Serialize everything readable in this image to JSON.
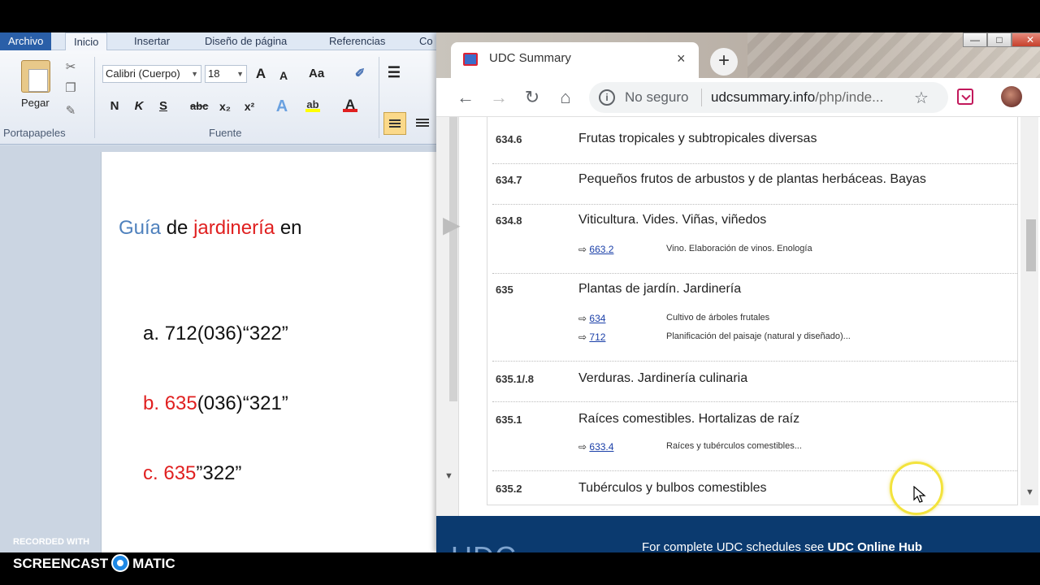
{
  "word": {
    "tabs": [
      "Archivo",
      "Inicio",
      "Insertar",
      "Diseño de página",
      "Referencias",
      "Co"
    ],
    "clipboard": {
      "paste_label": "Pegar",
      "group_label": "Portapapeles"
    },
    "font": {
      "name": "Calibri (Cuerpo)",
      "size": "18",
      "group_label": "Fuente"
    },
    "format_buttons": [
      "N",
      "K",
      "S",
      "abc",
      "x₂",
      "x²"
    ],
    "grow_font": "A",
    "shrink_font": "A",
    "change_case": "Aa",
    "document": {
      "heading": {
        "part1": "Guía",
        "part2": "de",
        "part3": "jardinería",
        "part4": "en"
      },
      "options": [
        {
          "letter": "a.",
          "code": "712(036)“322”"
        },
        {
          "letter": "b.",
          "code_red": "635",
          "code": "(036)“321”"
        },
        {
          "letter": "c.",
          "code_red": "635",
          "code": "”322”"
        }
      ]
    }
  },
  "chrome": {
    "tab_title": "UDC Summary",
    "tab_close": "×",
    "new_tab": "+",
    "security": "No seguro",
    "url_main": "udcsummary.info",
    "url_path": "/php/inde...",
    "window_controls": {
      "minimize": "—",
      "maximize": "□",
      "close": "✕"
    }
  },
  "entries": [
    {
      "code": "634.6",
      "desc": "Frutas tropicales y subtropicales diversas",
      "refs": []
    },
    {
      "code": "634.7",
      "desc": "Pequeños frutos de arbustos y de plantas herbáceas. Bayas",
      "refs": []
    },
    {
      "code": "634.8",
      "desc": "Viticultura. Vides. Viñas, viñedos",
      "refs": [
        {
          "arrow": "⇨",
          "link": "663.2",
          "text": "Vino. Elaboración de vinos. Enología"
        }
      ]
    },
    {
      "code": "635",
      "desc": "Plantas de jardín. Jardinería",
      "refs": [
        {
          "arrow": "⇨",
          "link": "634",
          "text": "Cultivo de árboles frutales"
        },
        {
          "arrow": "⇨",
          "link": "712",
          "text": "Planificación del paisaje (natural y diseñado)..."
        }
      ]
    },
    {
      "code": "635.1/.8",
      "desc": "Verduras. Jardinería culinaria",
      "refs": []
    },
    {
      "code": "635.1",
      "desc": "Raíces comestibles. Hortalizas de raíz",
      "refs": [
        {
          "arrow": "⇨",
          "link": "633.4",
          "text": "Raíces y tubérculos comestibles..."
        }
      ]
    },
    {
      "code": "635.2",
      "desc": "Tubérculos y bulbos comestibles",
      "refs": []
    }
  ],
  "footer": {
    "logo": "UDC",
    "text": "For complete UDC schedules see",
    "link": "UDC Online Hub"
  },
  "watermark": {
    "small": "RECORDED WITH",
    "left": "SCREENCAST",
    "right": "MATIC"
  }
}
